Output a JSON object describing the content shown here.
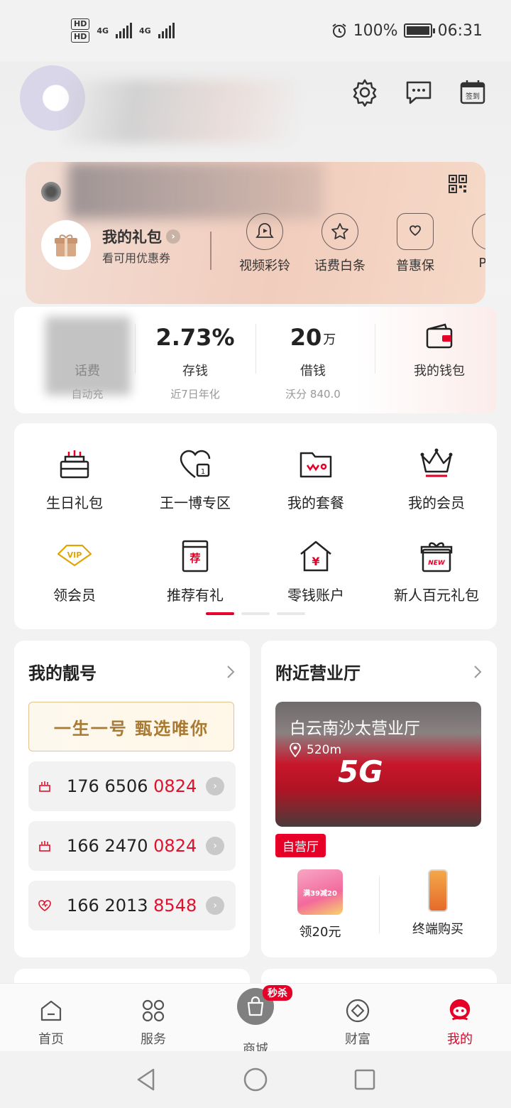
{
  "status_bar": {
    "hd1": "HD",
    "hd2": "HD",
    "net1": "4G",
    "net2": "4G",
    "battery": "100%",
    "time": "06:31"
  },
  "header": {
    "icons": [
      "settings-icon",
      "message-icon",
      "checkin-calendar-icon"
    ],
    "checkin_label": "签到"
  },
  "member_card": {
    "gift_title": "我的礼包",
    "gift_sub": "看可用优惠券",
    "items": [
      {
        "label": "视频彩铃",
        "icon": "video-ringtone-icon"
      },
      {
        "label": "话费白条",
        "icon": "star-icon"
      },
      {
        "label": "普惠保",
        "icon": "shield-heart-icon"
      },
      {
        "label": "PLU",
        "icon": "plus-icon"
      }
    ]
  },
  "finance": {
    "balance": {
      "label": "话费",
      "sub": "自动充"
    },
    "savings": {
      "value": "2.73%",
      "label": "存钱",
      "sub": "近7日年化"
    },
    "loan": {
      "value": "20",
      "unit": "万",
      "label": "借钱",
      "sub": "沃分 840.0"
    },
    "wallet": {
      "label": "我的钱包"
    }
  },
  "grid": {
    "items": [
      {
        "label": "生日礼包",
        "icon": "birthday-cake-icon"
      },
      {
        "label": "王一博专区",
        "icon": "heart-calendar-icon"
      },
      {
        "label": "我的套餐",
        "icon": "folder-icon"
      },
      {
        "label": "我的会员",
        "icon": "crown-icon"
      },
      {
        "label": "领会员",
        "icon": "vip-diamond-icon"
      },
      {
        "label": "推荐有礼",
        "icon": "recommend-icon"
      },
      {
        "label": "零钱账户",
        "icon": "house-yen-icon"
      },
      {
        "label": "新人百元礼包",
        "icon": "new-gift-icon"
      }
    ],
    "recommend_char": "荐",
    "yen_char": "¥",
    "vip_text": "VIP",
    "new_text": "NEW",
    "page_count": 3,
    "page_active": 0
  },
  "my_numbers": {
    "title": "我的靓号",
    "banner": "一生一号 甄选唯你",
    "rows": [
      {
        "prefix": "176 6506 ",
        "highlight": "0824",
        "icon": "cake-icon"
      },
      {
        "prefix": "166 2470 ",
        "highlight": "0824",
        "icon": "cake-icon"
      },
      {
        "prefix": "166 2013 ",
        "highlight": "8548",
        "icon": "heart-icon"
      }
    ]
  },
  "nearby": {
    "title": "附近营业厅",
    "store_name": "白云南沙太营业厅",
    "distance": "520m",
    "photo_text": "5G",
    "badge": "自营厅",
    "items": [
      {
        "label": "领20元",
        "icon": "coupon-image"
      },
      {
        "label": "终端购买",
        "icon": "phone-image"
      }
    ],
    "promo_text": "满39减20"
  },
  "tab_bar": {
    "tabs": [
      {
        "label": "首页",
        "icon": "home-icon"
      },
      {
        "label": "服务",
        "icon": "services-icon"
      },
      {
        "label": "商城",
        "icon": "shopping-bag-icon"
      },
      {
        "label": "财富",
        "icon": "wealth-icon"
      },
      {
        "label": "我的",
        "icon": "profile-icon"
      }
    ],
    "mall_badge": "秒杀",
    "active": "我的",
    "active_color": "#e60027"
  },
  "nav_bar": {
    "buttons": [
      "back-icon",
      "home-circle-icon",
      "recents-icon"
    ]
  }
}
